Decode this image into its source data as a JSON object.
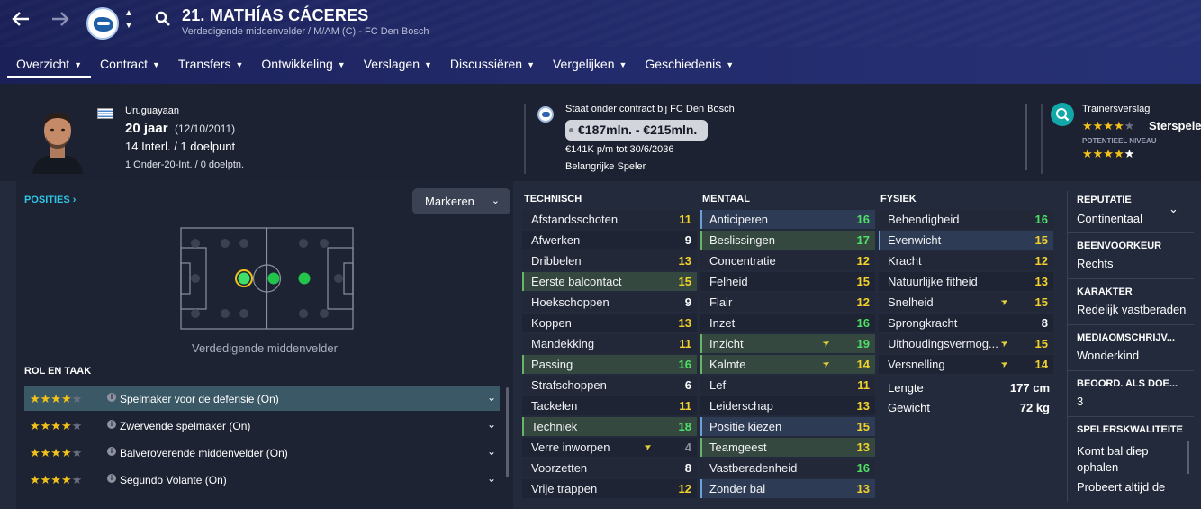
{
  "header": {
    "title": "21. MATHÍAS CÁCERES",
    "subtitle": "Verdedigende middenvelder / M/AM (C) - FC Den Bosch"
  },
  "tabs": [
    {
      "label": "Overzicht"
    },
    {
      "label": "Contract"
    },
    {
      "label": "Transfers"
    },
    {
      "label": "Ontwikkeling"
    },
    {
      "label": "Verslagen"
    },
    {
      "label": "Discussiëren"
    },
    {
      "label": "Vergelijken"
    },
    {
      "label": "Geschiedenis"
    }
  ],
  "info": {
    "nationality": "Uruguayaan",
    "age": "20 jaar",
    "dob": "(12/10/2011)",
    "caps": "14 Interl. / 1 doelpunt",
    "youth_caps": "1 Onder-20-Int. / 0 doelptn.",
    "contract_label": "Staat onder contract bij FC Den Bosch",
    "value": "€187mln. - €215mln.",
    "wage": "€141K p/m tot 30/6/2036",
    "squad_status": "Belangrijke Speler",
    "coach_report_label": "Trainersverslag",
    "current_ability_stars": 3.5,
    "current_ability_text": "Sterspeler",
    "potential_label": "POTENTIEEL NIVEAU",
    "potential_stars": 4.5
  },
  "positions": {
    "label": "POSITIES",
    "mark_button": "Markeren",
    "caption": "Verdedigende middenvelder"
  },
  "roles": {
    "title": "ROL EN TAAK",
    "items": [
      {
        "label": "Spelmaker voor de defensie (On)",
        "stars": 4
      },
      {
        "label": "Zwervende spelmaker (On)",
        "stars": 4
      },
      {
        "label": "Balveroverende middenvelder (On)",
        "stars": 4
      },
      {
        "label": "Segundo Volante (On)",
        "stars": 4
      }
    ]
  },
  "technical": {
    "title": "TECHNISCH",
    "rows": [
      {
        "name": "Afstandsschoten",
        "value": "11",
        "c": "yellow"
      },
      {
        "name": "Afwerken",
        "value": "9",
        "c": "white"
      },
      {
        "name": "Dribbelen",
        "value": "13",
        "c": "yellow"
      },
      {
        "name": "Eerste balcontact",
        "value": "15",
        "c": "yellow",
        "h": "hg"
      },
      {
        "name": "Hoekschoppen",
        "value": "9",
        "c": "white"
      },
      {
        "name": "Koppen",
        "value": "13",
        "c": "yellow"
      },
      {
        "name": "Mandekking",
        "value": "11",
        "c": "yellow"
      },
      {
        "name": "Passing",
        "value": "16",
        "c": "green",
        "h": "hg"
      },
      {
        "name": "Strafschoppen",
        "value": "6",
        "c": "white"
      },
      {
        "name": "Tackelen",
        "value": "11",
        "c": "yellow"
      },
      {
        "name": "Techniek",
        "value": "18",
        "c": "green",
        "h": "hg"
      },
      {
        "name": "Verre inworpen",
        "value": "4",
        "c": "grey",
        "arrow": true
      },
      {
        "name": "Voorzetten",
        "value": "8",
        "c": "white"
      },
      {
        "name": "Vrije trappen",
        "value": "12",
        "c": "yellow"
      }
    ]
  },
  "mental": {
    "title": "MENTAAL",
    "rows": [
      {
        "name": "Anticiperen",
        "value": "16",
        "c": "green",
        "h": "hb"
      },
      {
        "name": "Beslissingen",
        "value": "17",
        "c": "green",
        "h": "hg"
      },
      {
        "name": "Concentratie",
        "value": "12",
        "c": "yellow"
      },
      {
        "name": "Felheid",
        "value": "15",
        "c": "yellow"
      },
      {
        "name": "Flair",
        "value": "12",
        "c": "yellow"
      },
      {
        "name": "Inzet",
        "value": "16",
        "c": "green"
      },
      {
        "name": "Inzicht",
        "value": "19",
        "c": "green",
        "h": "hg",
        "arrow": true
      },
      {
        "name": "Kalmte",
        "value": "14",
        "c": "yellow",
        "h": "hg",
        "arrow": true
      },
      {
        "name": "Lef",
        "value": "11",
        "c": "yellow"
      },
      {
        "name": "Leiderschap",
        "value": "13",
        "c": "yellow"
      },
      {
        "name": "Positie kiezen",
        "value": "15",
        "c": "yellow",
        "h": "hb"
      },
      {
        "name": "Teamgeest",
        "value": "13",
        "c": "yellow",
        "h": "hg"
      },
      {
        "name": "Vastberadenheid",
        "value": "16",
        "c": "green"
      },
      {
        "name": "Zonder bal",
        "value": "13",
        "c": "yellow",
        "h": "hb"
      }
    ]
  },
  "physical": {
    "title": "FYSIEK",
    "rows": [
      {
        "name": "Behendigheid",
        "value": "16",
        "c": "green"
      },
      {
        "name": "Evenwicht",
        "value": "15",
        "c": "yellow",
        "h": "hb"
      },
      {
        "name": "Kracht",
        "value": "12",
        "c": "yellow"
      },
      {
        "name": "Natuurlijke fitheid",
        "value": "13",
        "c": "yellow"
      },
      {
        "name": "Snelheid",
        "value": "15",
        "c": "yellow",
        "arrow": true
      },
      {
        "name": "Sprongkracht",
        "value": "8",
        "c": "white"
      },
      {
        "name": "Uithoudingsvermog...",
        "value": "15",
        "c": "yellow",
        "arrow": true
      },
      {
        "name": "Versnelling",
        "value": "14",
        "c": "yellow",
        "arrow": true
      }
    ],
    "height_label": "Lengte",
    "height": "177 cm",
    "weight_label": "Gewicht",
    "weight": "72 kg"
  },
  "side": {
    "reputation_h": "REPUTATIE",
    "reputation": "Continentaal",
    "foot_h": "BEENVOORKEUR",
    "foot": "Rechts",
    "character_h": "KARAKTER",
    "character": "Redelijk vastberaden",
    "media_h": "MEDIAOMSCHRIJV...",
    "media": "Wonderkind",
    "gk_h": "BEOORD. ALS DOE...",
    "gk": "3",
    "traits_h": "SPELERSKWALITEITE",
    "trait1a": "Komt bal diep",
    "trait1b": "ophalen",
    "trait2": "Probeert altijd de"
  },
  "colors": {
    "green": "#4fe067",
    "yellow": "#f2d22a",
    "accent": "#2ec6e6"
  }
}
